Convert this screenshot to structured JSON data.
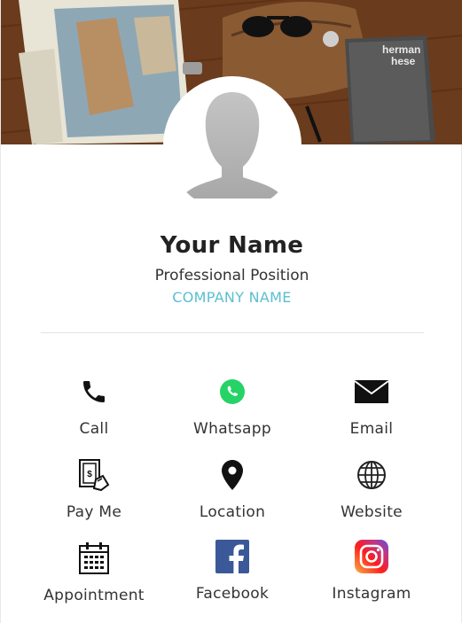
{
  "profile": {
    "name": "Your Name",
    "position": "Professional Position",
    "company": "COMPANY NAME"
  },
  "cover": {
    "book_title_line1": "herman",
    "book_title_line2": "hese"
  },
  "actions": [
    {
      "label": "Call",
      "icon": "phone-icon"
    },
    {
      "label": "Whatsapp",
      "icon": "whatsapp-icon"
    },
    {
      "label": "Email",
      "icon": "email-icon"
    },
    {
      "label": "Pay Me",
      "icon": "payment-icon"
    },
    {
      "label": "Location",
      "icon": "location-pin-icon"
    },
    {
      "label": "Website",
      "icon": "globe-icon"
    },
    {
      "label": "Appointment",
      "icon": "calendar-icon"
    },
    {
      "label": "Facebook",
      "icon": "facebook-icon"
    },
    {
      "label": "Instagram",
      "icon": "instagram-icon"
    }
  ],
  "colors": {
    "company": "#5bbfd0",
    "whatsapp": "#25d366",
    "facebook": "#3b5998"
  }
}
